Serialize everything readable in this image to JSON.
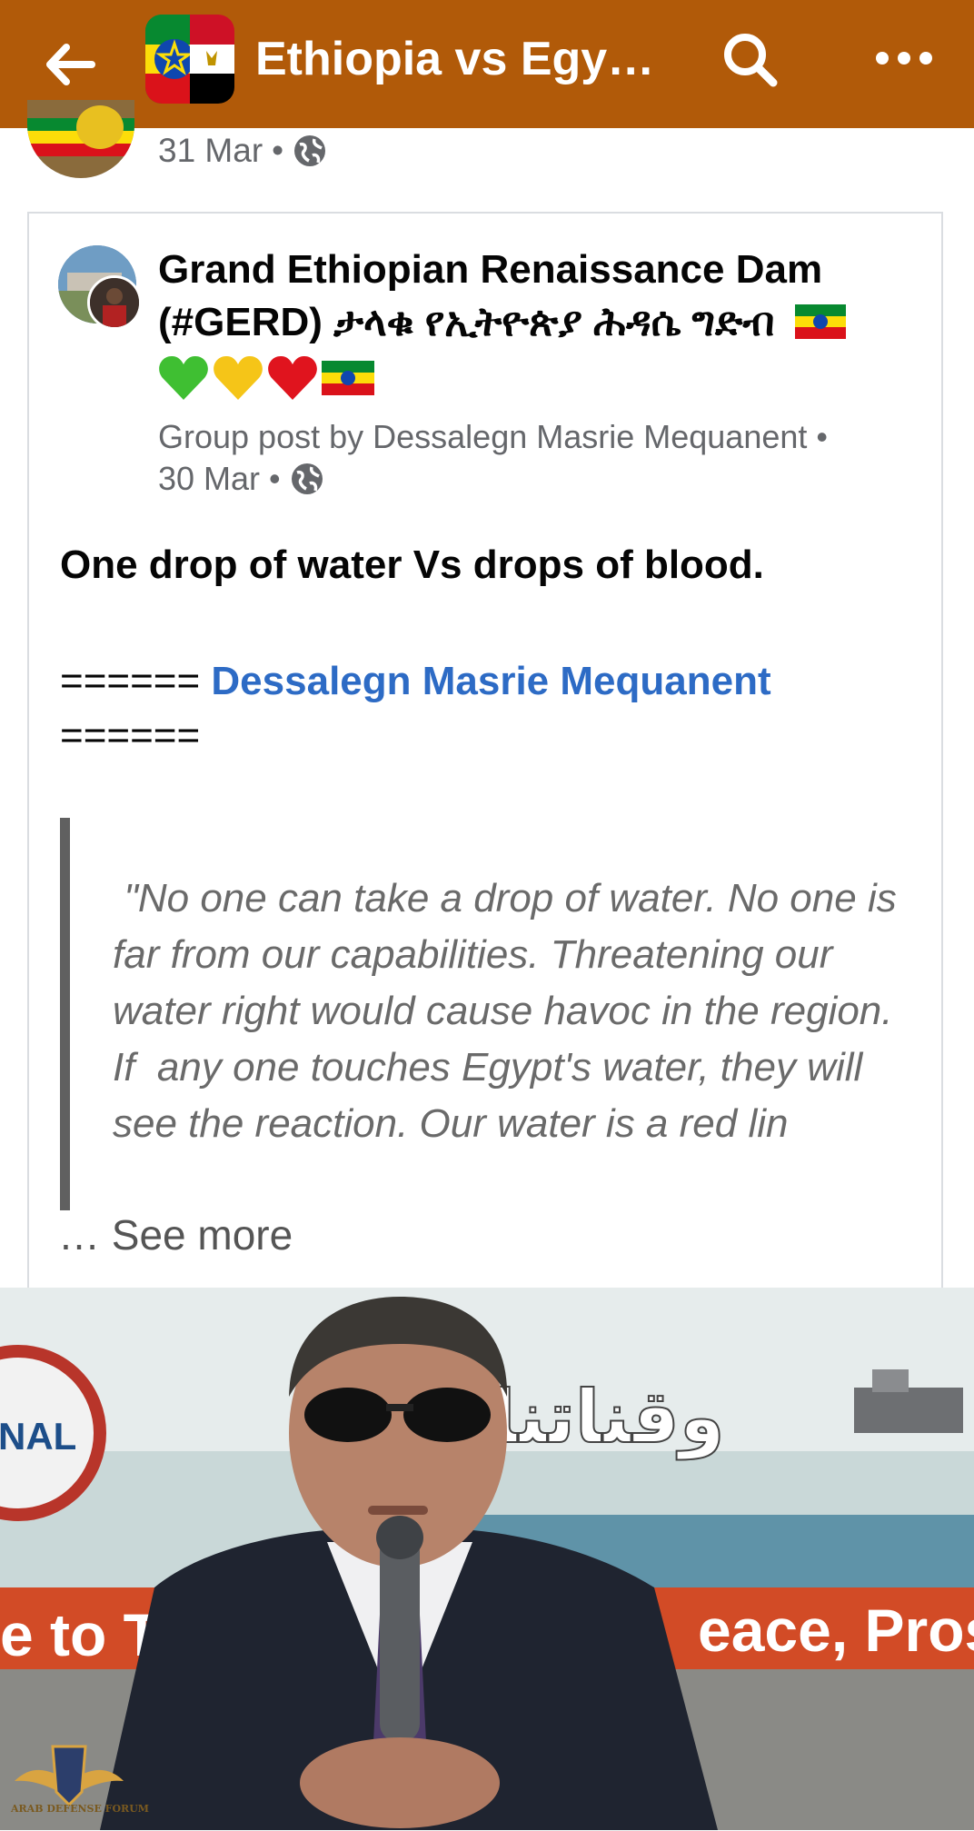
{
  "topbar": {
    "title": "Ethiopia vs Egypt…",
    "back_icon": "arrow-left-icon",
    "search_icon": "search-icon",
    "more_icon": "more-horizontal-icon",
    "background_color": "#b15a09"
  },
  "sharer": {
    "date": "31 Mar",
    "separator": "•",
    "privacy_icon": "globe-icon"
  },
  "shared_post": {
    "group_name": "Grand Ethiopian Renaissance Dam (#GERD) ታላቁ የኢትዮጵያ ሕዳሴ ግድብ",
    "group_emojis": [
      "green-heart",
      "yellow-heart",
      "red-heart",
      "ethiopia-flag"
    ],
    "meta_line": "Group post by Dessalegn Masrie Mequanent •",
    "date": "30 Mar",
    "separator": "•",
    "privacy_icon": "globe-icon",
    "headline": "One drop of water Vs drops of blood.",
    "separator_prefix": "====== ",
    "author_link": "Dessalegn Masrie Mequanent",
    "separator_suffix": "======",
    "quote": " \"No one can take a drop of water. No one is far from our capabilities. Threatening our water right would cause havoc in the region. If  any one touches Egypt's water, they will see the reaction. Our water is a red lin",
    "see_more": "… See more"
  },
  "photo": {
    "banner_text_left": "NAL",
    "banner_text_bottom_left": "e to The",
    "banner_text_bottom_right": "eace, Prosperity",
    "banner_arabic": "وقناتنا"
  },
  "watermark": {
    "text": "ARAB DEFENSE FORUM"
  }
}
